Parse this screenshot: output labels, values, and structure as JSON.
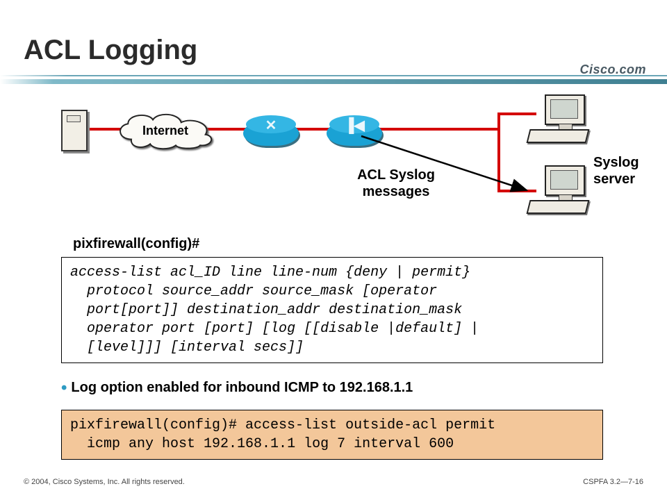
{
  "title": "ACL Logging",
  "brand": "Cisco.com",
  "diagram": {
    "cloud_label": "Internet",
    "arrow_label": "ACL Syslog\nmessages",
    "syslog_label": "Syslog\nserver"
  },
  "prompt": "pixfirewall(config)#",
  "syntax_code": "access-list acl_ID line line-num {deny | permit}\n  protocol source_addr source_mask [operator\n  port[port]] destination_addr destination_mask\n  operator port [port] [log [[disable |default] |\n  [level]]] [interval secs]]",
  "bullet": "Log option enabled for inbound ICMP to 192.168.1.1",
  "example_code": "pixfirewall(config)# access-list outside-acl permit\n  icmp any host 192.168.1.1 log 7 interval 600",
  "footer": {
    "left": "© 2004, Cisco Systems, Inc. All rights reserved.",
    "right": "CSPFA 3.2—7-16"
  }
}
